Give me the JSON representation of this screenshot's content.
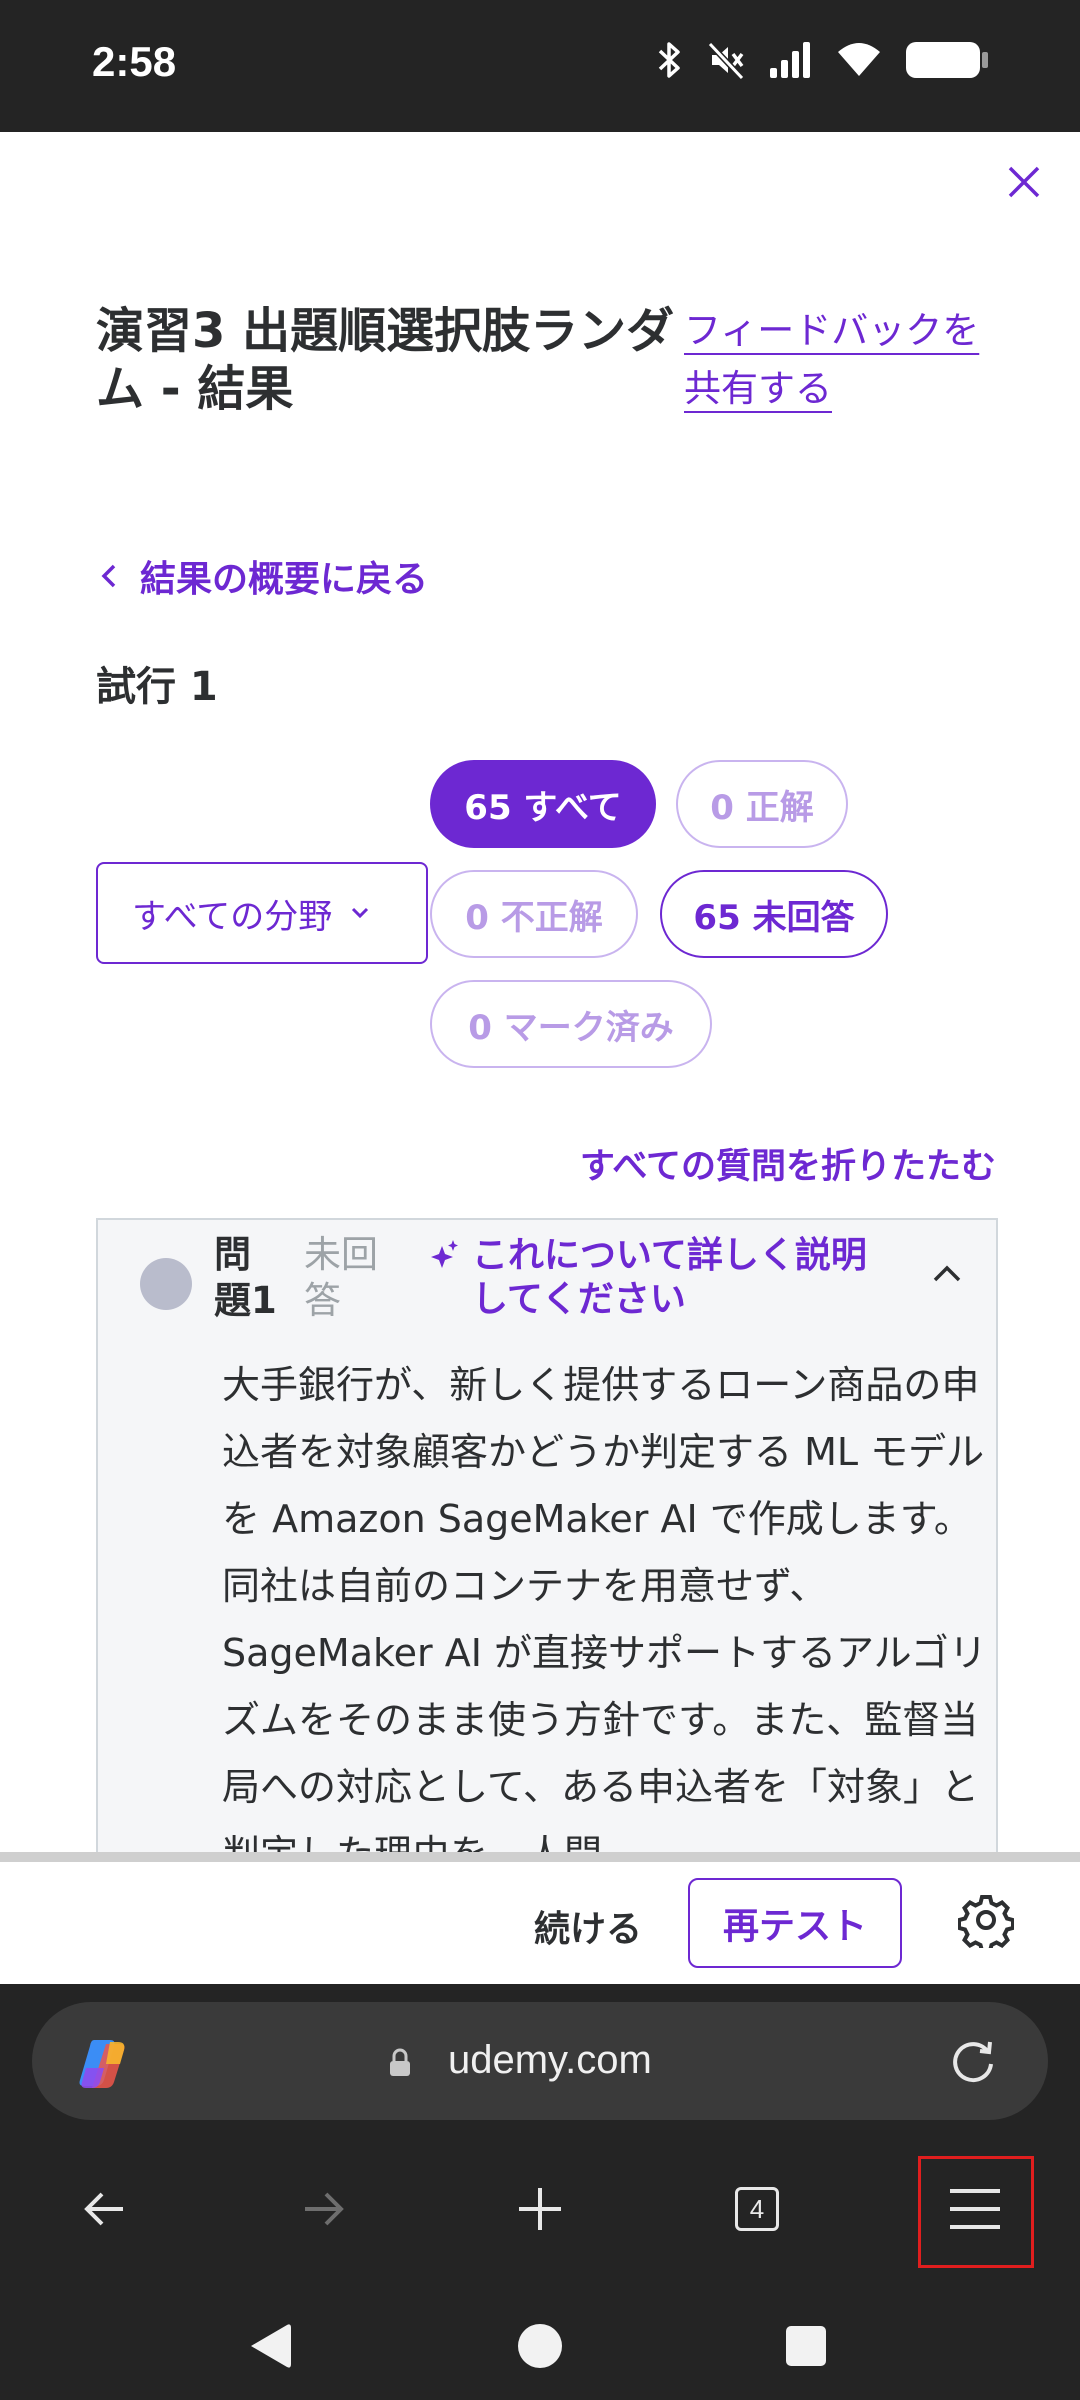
{
  "status_bar": {
    "time": "2:58"
  },
  "page": {
    "title": "演習3 出題順選択肢ランダム - 結果",
    "feedback_link": "フィードバックを共有する",
    "back_link": "結果の概要に戻る",
    "attempt_label": "試行 1"
  },
  "filters": {
    "all": "65 すべて",
    "correct": "0 正解",
    "incorrect": "0 不正解",
    "unanswered": "65 未回答",
    "marked": "0 マーク済み",
    "domain_select": "すべての分野"
  },
  "collapse_all": "すべての質問を折りたたむ",
  "question": {
    "number": "問題1",
    "status": "未回答",
    "explain_label": "これについて詳しく説明してください",
    "text": "大手銀行が、新しく提供するローン商品の申込者を対象顧客かどうか判定する ML モデルを Amazon SageMaker AI で作成します。同社は自前のコンテナを用意せず、SageMaker AI が直接サポートするアルゴリズムをそのまま使う方針です。また、監督当局への対応として、ある申込者を「対象」と判定した理由を、人間"
  },
  "actions": {
    "continue": "続ける",
    "retest": "再テスト"
  },
  "browser": {
    "url": "udemy.com",
    "tab_count": "4"
  },
  "colors": {
    "accent": "#6d28d2",
    "highlight": "#e01e1e"
  }
}
